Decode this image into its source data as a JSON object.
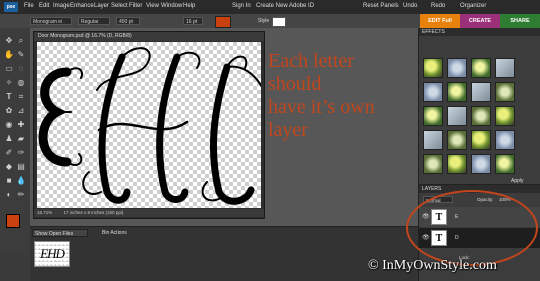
{
  "app": {
    "logo": "pse",
    "menu": [
      "File",
      "Edit",
      "Image",
      "Enhance",
      "Layer",
      "Select",
      "Filter",
      "View",
      "Window",
      "Help"
    ],
    "account": [
      "Sign In",
      "Create New Adobe ID"
    ],
    "actions": [
      "Reset Panels",
      "Undo",
      "Redo",
      "Organizer"
    ]
  },
  "options": {
    "font": "Monogram ei",
    "style": "Regular",
    "size": "450 pt",
    "leading": "16 pt",
    "style_label": "Style",
    "color": "#c8410f"
  },
  "modes": [
    {
      "label": "EDIT Full",
      "color": "#e8820c"
    },
    {
      "label": "CREATE",
      "color": "#9c2f7a"
    },
    {
      "label": "SHARE",
      "color": "#2e7d32"
    }
  ],
  "document": {
    "title": "Door Monogram.psd @ 16.7% (D, RGB/8)",
    "zoom": "16.71%",
    "size": "17 inches x 8 inches (150 ppi)",
    "letters": [
      "E",
      "H",
      "D"
    ]
  },
  "annotation": {
    "lines": [
      "Each letter",
      "should",
      "have it’s own",
      "layer"
    ],
    "color": "#c2461c"
  },
  "bin": {
    "show_files": "Show Open Files",
    "bin_actions": "Bin Actions"
  },
  "effects": {
    "title": "EFFECTS",
    "apply": "Apply"
  },
  "layers": {
    "title": "LAYERS",
    "blend": "Normal",
    "opacity_label": "Opacity:",
    "opacity": "100%",
    "lock_label": "Lock:",
    "rows": [
      {
        "glyph": "T",
        "name": "E"
      },
      {
        "glyph": "T",
        "name": "D"
      }
    ]
  },
  "watermark": "© InMyOwnStyle.com"
}
